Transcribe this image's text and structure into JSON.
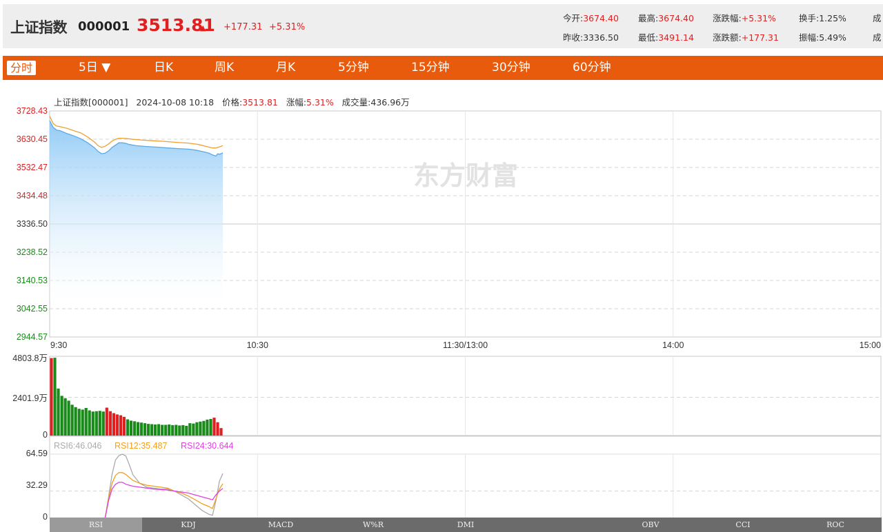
{
  "header": {
    "name": "上证指数",
    "code": "000001",
    "price": "3513.81",
    "arrow": "▲",
    "change": "+177.31",
    "change_pct": "+5.31%",
    "stats_row1": [
      {
        "label": "今开:",
        "value": "3674.40"
      },
      {
        "label": "最高:",
        "value": "3674.40"
      },
      {
        "label": "涨跌幅:",
        "value": "+5.31%"
      },
      {
        "label": "换手:",
        "value": "1.25%"
      },
      {
        "label": "成",
        "value": ""
      }
    ],
    "stats_row2": [
      {
        "label": "昨收:",
        "value": "3336.50"
      },
      {
        "label": "最低:",
        "value": "3491.14"
      },
      {
        "label": "涨跌额:",
        "value": "+177.31"
      },
      {
        "label": "振幅:",
        "value": "5.49%"
      },
      {
        "label": "成",
        "value": ""
      }
    ]
  },
  "tabs": [
    "分时",
    "5日 ▼",
    "日K",
    "周K",
    "月K",
    "5分钟",
    "15分钟",
    "30分钟",
    "60分钟"
  ],
  "active_tab": "分时",
  "info_line": {
    "name": "上证指数[000001]",
    "datetime": "2024-10-08 10:18",
    "price_label": "价格:",
    "price": "3513.81",
    "pct_label": "涨幅:",
    "pct": "5.31%",
    "volume_label": "成交量:",
    "volume": "436.96万"
  },
  "watermark": "东方财富",
  "rsi_legend": {
    "rsi6": "RSI6:46.046",
    "rsi12": "RSI12:35.487",
    "rsi24": "RSI24:30.644"
  },
  "indicator_tabs": [
    "RSI",
    "KDJ",
    "MACD",
    "W%R",
    "DMI",
    "",
    "OBV",
    "CCI",
    "ROC"
  ],
  "active_indicator": "RSI",
  "colors": {
    "up": "#e02020",
    "down": "#1a8a1a",
    "price_line": "#5aa8e8",
    "avg_line": "#f0a030",
    "tab_bar": "#e85a0c",
    "rsi6": "#aaaaaa",
    "rsi12": "#f0a020",
    "rsi24": "#e040e0"
  },
  "chart_data": {
    "type": "line",
    "price_axis": {
      "ticks": [
        "3728.43",
        "3630.45",
        "3532.47",
        "3434.48",
        "3336.50",
        "3238.52",
        "3140.53",
        "3042.55",
        "2944.57"
      ],
      "prev_close": 3336.5,
      "ylim": [
        2944.57,
        3728.43
      ]
    },
    "time_axis": {
      "labels": [
        "9:30",
        "10:30",
        "11:30/13:00",
        "14:00",
        "15:00"
      ],
      "total_minutes": 240
    },
    "price_series": [
      [
        0,
        3695
      ],
      [
        1,
        3672
      ],
      [
        2,
        3662
      ],
      [
        3,
        3660
      ],
      [
        5,
        3650
      ],
      [
        7,
        3642
      ],
      [
        9,
        3632
      ],
      [
        11,
        3618
      ],
      [
        13,
        3600
      ],
      [
        14,
        3588
      ],
      [
        15,
        3580
      ],
      [
        16,
        3582
      ],
      [
        17,
        3590
      ],
      [
        18,
        3602
      ],
      [
        19,
        3610
      ],
      [
        20,
        3618
      ],
      [
        21,
        3618
      ],
      [
        22,
        3616
      ],
      [
        23,
        3612
      ],
      [
        25,
        3608
      ],
      [
        28,
        3605
      ],
      [
        31,
        3603
      ],
      [
        34,
        3600
      ],
      [
        37,
        3598
      ],
      [
        40,
        3596
      ],
      [
        42,
        3593
      ],
      [
        44,
        3588
      ],
      [
        46,
        3582
      ],
      [
        47,
        3576
      ],
      [
        48,
        3572
      ],
      [
        49,
        3578
      ],
      [
        50,
        3583
      ],
      [
        48.5,
        3580
      ]
    ],
    "avg_series": [
      [
        0,
        3710
      ],
      [
        1,
        3685
      ],
      [
        2,
        3676
      ],
      [
        3,
        3674
      ],
      [
        5,
        3668
      ],
      [
        7,
        3660
      ],
      [
        9,
        3652
      ],
      [
        11,
        3638
      ],
      [
        13,
        3620
      ],
      [
        14,
        3608
      ],
      [
        15,
        3602
      ],
      [
        16,
        3606
      ],
      [
        17,
        3614
      ],
      [
        18,
        3624
      ],
      [
        19,
        3630
      ],
      [
        20,
        3634
      ],
      [
        22,
        3633
      ],
      [
        24,
        3630
      ],
      [
        27,
        3627
      ],
      [
        30,
        3625
      ],
      [
        33,
        3623
      ],
      [
        36,
        3620
      ],
      [
        40,
        3617
      ],
      [
        43,
        3612
      ],
      [
        45,
        3606
      ],
      [
        47,
        3600
      ],
      [
        48,
        3600
      ],
      [
        49,
        3604
      ],
      [
        50,
        3608
      ]
    ],
    "volume": {
      "ticks": [
        "4803.8万",
        "2401.9万",
        "0"
      ],
      "max": 4803.8,
      "bars": [
        {
          "v": 4780,
          "up": true
        },
        {
          "v": 4800,
          "up": false
        },
        {
          "v": 2900,
          "up": false
        },
        {
          "v": 2450,
          "up": false
        },
        {
          "v": 2300,
          "up": false
        },
        {
          "v": 2150,
          "up": false
        },
        {
          "v": 1900,
          "up": false
        },
        {
          "v": 1750,
          "up": false
        },
        {
          "v": 1650,
          "up": false
        },
        {
          "v": 1600,
          "up": false
        },
        {
          "v": 1700,
          "up": false
        },
        {
          "v": 1550,
          "up": false
        },
        {
          "v": 1480,
          "up": false
        },
        {
          "v": 1500,
          "up": false
        },
        {
          "v": 1520,
          "up": false
        },
        {
          "v": 1480,
          "up": false
        },
        {
          "v": 1720,
          "up": true
        },
        {
          "v": 1500,
          "up": true
        },
        {
          "v": 1380,
          "up": true
        },
        {
          "v": 1300,
          "up": true
        },
        {
          "v": 1250,
          "up": true
        },
        {
          "v": 1150,
          "up": true
        },
        {
          "v": 1000,
          "up": false
        },
        {
          "v": 920,
          "up": false
        },
        {
          "v": 880,
          "up": false
        },
        {
          "v": 830,
          "up": false
        },
        {
          "v": 800,
          "up": false
        },
        {
          "v": 760,
          "up": false
        },
        {
          "v": 720,
          "up": false
        },
        {
          "v": 700,
          "up": false
        },
        {
          "v": 680,
          "up": false
        },
        {
          "v": 700,
          "up": false
        },
        {
          "v": 660,
          "up": false
        },
        {
          "v": 660,
          "up": false
        },
        {
          "v": 680,
          "up": false
        },
        {
          "v": 640,
          "up": false
        },
        {
          "v": 660,
          "up": false
        },
        {
          "v": 620,
          "up": false
        },
        {
          "v": 640,
          "up": false
        },
        {
          "v": 600,
          "up": false
        },
        {
          "v": 760,
          "up": false
        },
        {
          "v": 740,
          "up": false
        },
        {
          "v": 820,
          "up": false
        },
        {
          "v": 860,
          "up": false
        },
        {
          "v": 900,
          "up": false
        },
        {
          "v": 980,
          "up": false
        },
        {
          "v": 1020,
          "up": false
        },
        {
          "v": 1100,
          "up": true
        },
        {
          "v": 820,
          "up": true
        },
        {
          "v": 460,
          "up": true
        }
      ]
    },
    "rsi": {
      "ticks": [
        "64.59",
        "32.29",
        "0"
      ],
      "max": 64.59,
      "rsi6": [
        [
          16,
          0
        ],
        [
          17,
          22
        ],
        [
          18,
          45
        ],
        [
          19,
          60
        ],
        [
          20,
          64.5
        ],
        [
          21,
          66
        ],
        [
          22,
          64
        ],
        [
          23,
          55
        ],
        [
          24,
          45
        ],
        [
          26,
          36
        ],
        [
          28,
          32
        ],
        [
          30,
          31
        ],
        [
          32,
          30
        ],
        [
          34,
          30
        ],
        [
          36,
          28
        ],
        [
          38,
          24
        ],
        [
          40,
          20
        ],
        [
          42,
          14
        ],
        [
          44,
          8
        ],
        [
          46,
          4
        ],
        [
          47,
          3
        ],
        [
          48,
          18
        ],
        [
          49,
          38
        ],
        [
          50,
          46
        ]
      ],
      "rsi12": [
        [
          16,
          0
        ],
        [
          17,
          20
        ],
        [
          18,
          36
        ],
        [
          19,
          44
        ],
        [
          20,
          47
        ],
        [
          21,
          47
        ],
        [
          22,
          45
        ],
        [
          23,
          42
        ],
        [
          24,
          39
        ],
        [
          26,
          36
        ],
        [
          28,
          34
        ],
        [
          30,
          33
        ],
        [
          32,
          32
        ],
        [
          34,
          31
        ],
        [
          36,
          28
        ],
        [
          38,
          26
        ],
        [
          40,
          23
        ],
        [
          42,
          19
        ],
        [
          44,
          15
        ],
        [
          46,
          12
        ],
        [
          47,
          10
        ],
        [
          48,
          20
        ],
        [
          49,
          30
        ],
        [
          50,
          35.5
        ]
      ],
      "rsi24": [
        [
          16,
          0
        ],
        [
          17,
          18
        ],
        [
          18,
          30
        ],
        [
          19,
          35
        ],
        [
          20,
          37
        ],
        [
          21,
          37
        ],
        [
          22,
          35
        ],
        [
          23,
          34
        ],
        [
          24,
          33
        ],
        [
          26,
          32
        ],
        [
          28,
          31
        ],
        [
          30,
          30
        ],
        [
          32,
          29.5
        ],
        [
          34,
          29
        ],
        [
          36,
          28
        ],
        [
          38,
          27
        ],
        [
          40,
          26
        ],
        [
          42,
          24
        ],
        [
          44,
          22
        ],
        [
          46,
          20
        ],
        [
          47,
          19
        ],
        [
          48,
          24
        ],
        [
          49,
          28
        ],
        [
          50,
          30.6
        ]
      ]
    }
  }
}
